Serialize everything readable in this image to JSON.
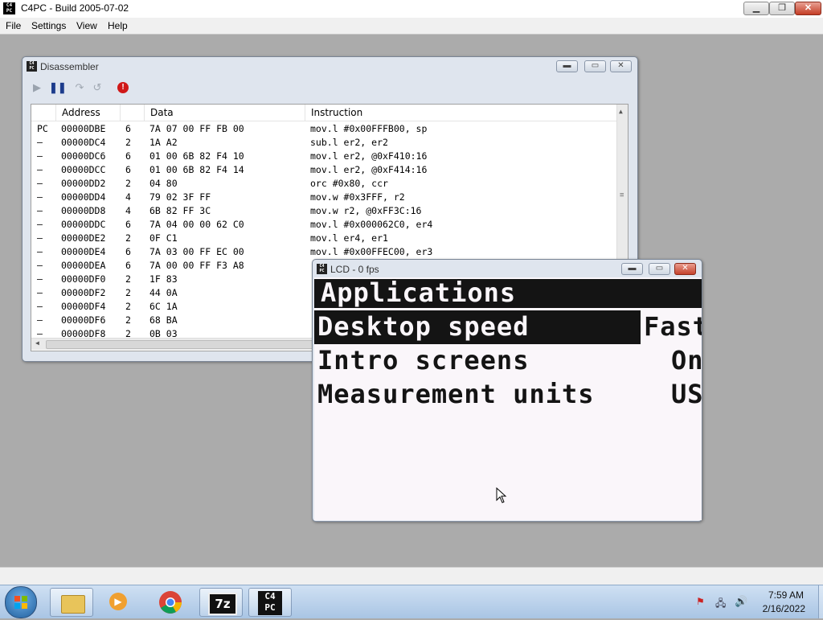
{
  "app": {
    "title": "C4PC - Build 2005-07-02",
    "icon_text": "C4\nPC"
  },
  "menu": [
    "File",
    "Settings",
    "View",
    "Help"
  ],
  "disassembler": {
    "title": "Disassembler",
    "columns": [
      "Address",
      "Data",
      "Instruction"
    ],
    "rows": [
      {
        "m": "PC",
        "addr": "00000DBE",
        "len": "6",
        "data": "7A 07 00 FF FB 00",
        "ins": "mov.l #0x00FFFB00, sp"
      },
      {
        "m": "–",
        "addr": "00000DC4",
        "len": "2",
        "data": "1A A2",
        "ins": "sub.l er2, er2"
      },
      {
        "m": "–",
        "addr": "00000DC6",
        "len": "6",
        "data": "01 00 6B 82 F4 10",
        "ins": "mov.l er2, @0xF410:16"
      },
      {
        "m": "–",
        "addr": "00000DCC",
        "len": "6",
        "data": "01 00 6B 82 F4 14",
        "ins": "mov.l er2, @0xF414:16"
      },
      {
        "m": "–",
        "addr": "00000DD2",
        "len": "2",
        "data": "04 80",
        "ins": "orc #0x80, ccr"
      },
      {
        "m": "–",
        "addr": "00000DD4",
        "len": "4",
        "data": "79 02 3F FF",
        "ins": "mov.w #0x3FFF, r2"
      },
      {
        "m": "–",
        "addr": "00000DD8",
        "len": "4",
        "data": "6B 82 FF 3C",
        "ins": "mov.w r2, @0xFF3C:16"
      },
      {
        "m": "–",
        "addr": "00000DDC",
        "len": "6",
        "data": "7A 04 00 00 62 C0",
        "ins": "mov.l #0x000062C0, er4"
      },
      {
        "m": "–",
        "addr": "00000DE2",
        "len": "2",
        "data": "0F C1",
        "ins": "mov.l er4, er1"
      },
      {
        "m": "–",
        "addr": "00000DE4",
        "len": "6",
        "data": "7A 03 00 FF EC 00",
        "ins": "mov.l #0x00FFEC00, er3"
      },
      {
        "m": "–",
        "addr": "00000DEA",
        "len": "6",
        "data": "7A 00 00 FF F3 A8",
        "ins": ""
      },
      {
        "m": "–",
        "addr": "00000DF0",
        "len": "2",
        "data": "1F 83",
        "ins": ""
      },
      {
        "m": "–",
        "addr": "00000DF2",
        "len": "2",
        "data": "44 0A",
        "ins": ""
      },
      {
        "m": "–",
        "addr": "00000DF4",
        "len": "2",
        "data": "6C 1A",
        "ins": ""
      },
      {
        "m": "–",
        "addr": "00000DF6",
        "len": "2",
        "data": "68 BA",
        "ins": ""
      },
      {
        "m": "–",
        "addr": "00000DF8",
        "len": "2",
        "data": "0B 03",
        "ins": ""
      }
    ]
  },
  "lcd": {
    "title": "LCD - 0 fps",
    "header": "Applications",
    "items": [
      {
        "label": "Desktop speed",
        "value": "Fast",
        "selected": true
      },
      {
        "label": "Intro screens",
        "value": "On",
        "selected": false
      },
      {
        "label": "Measurement units",
        "value": "US",
        "selected": false
      }
    ]
  },
  "taskbar": {
    "apps": [
      "start-orb",
      "file-explorer",
      "media-player",
      "chrome",
      "7-zip",
      "c4pc"
    ],
    "app_7z_text": "7z",
    "app_c4pc_text": "C4\nPC",
    "time": "7:59 AM",
    "date": "2/16/2022"
  },
  "colors": {
    "workspace": "#ababab",
    "lcd_bg": "#faf6fa",
    "lcd_fg": "#141414",
    "accent": "#3b5fa0"
  }
}
